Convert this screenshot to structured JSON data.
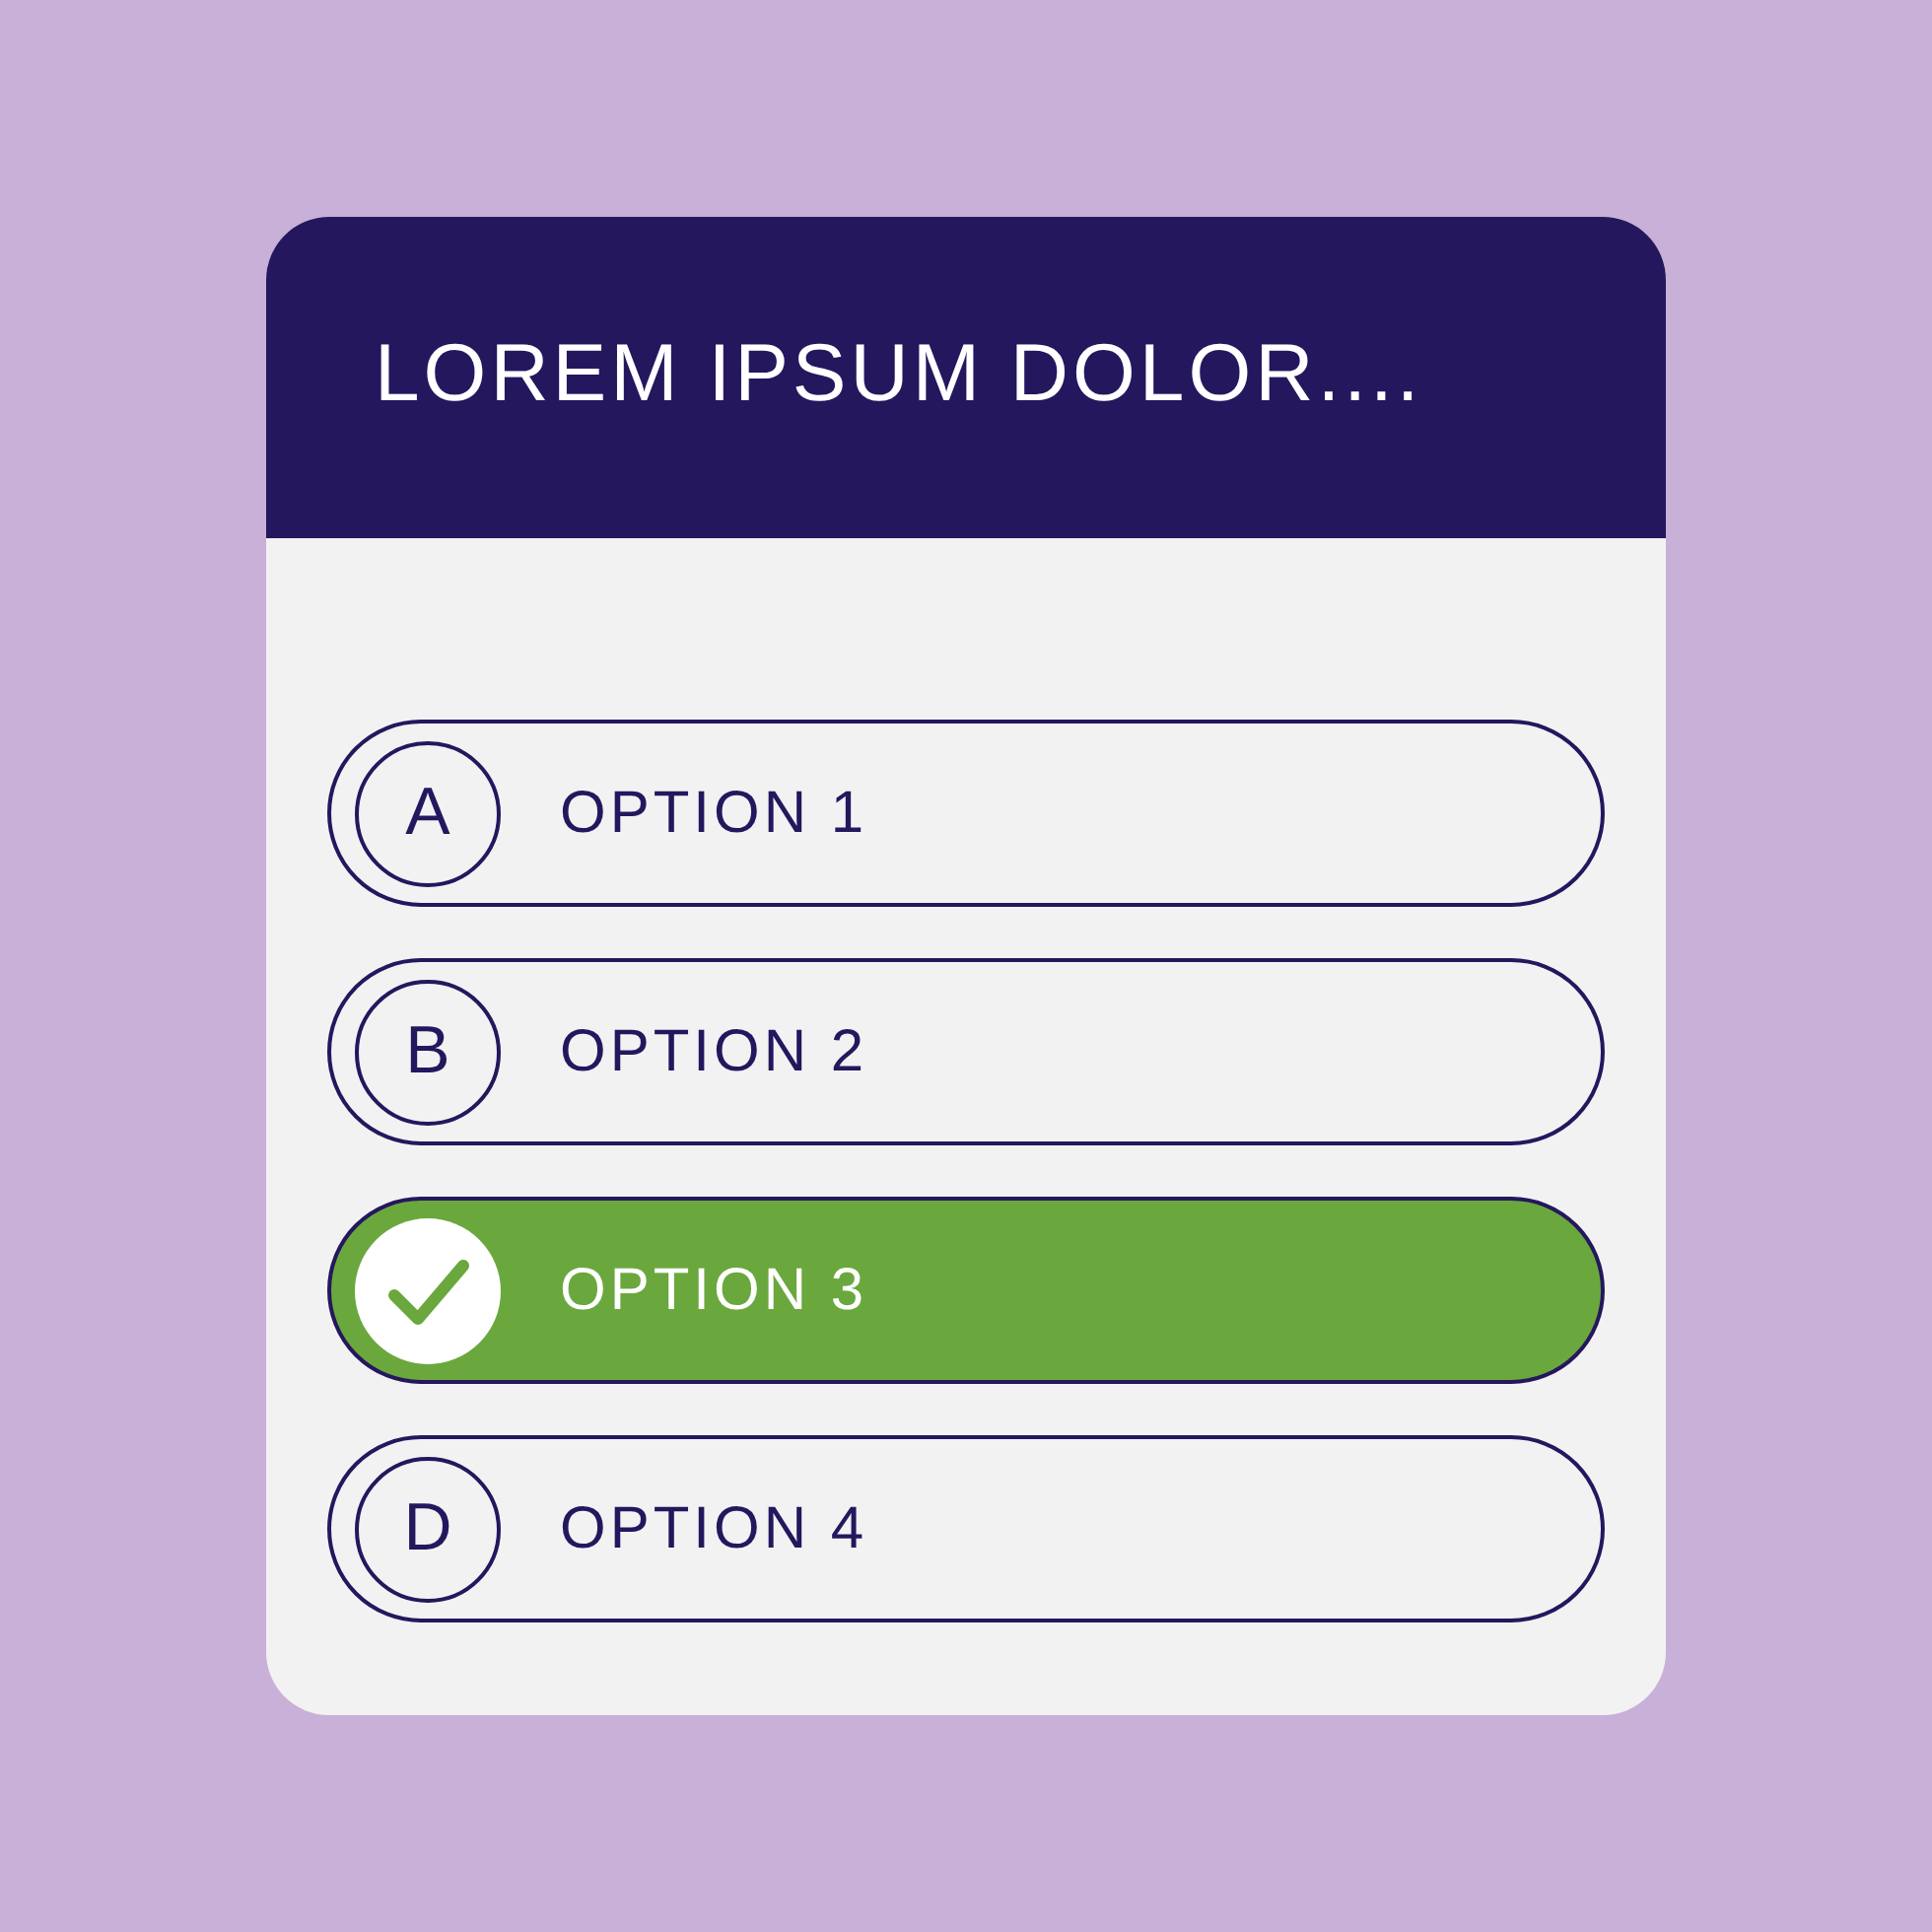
{
  "question": {
    "title": "LOREM IPSUM DOLOR...."
  },
  "options": [
    {
      "letter": "A",
      "label": "OPTION 1",
      "selected": false
    },
    {
      "letter": "B",
      "label": "OPTION 2",
      "selected": false
    },
    {
      "label": "OPTION 3",
      "selected": true
    },
    {
      "letter": "D",
      "label": "OPTION 4",
      "selected": false
    }
  ]
}
